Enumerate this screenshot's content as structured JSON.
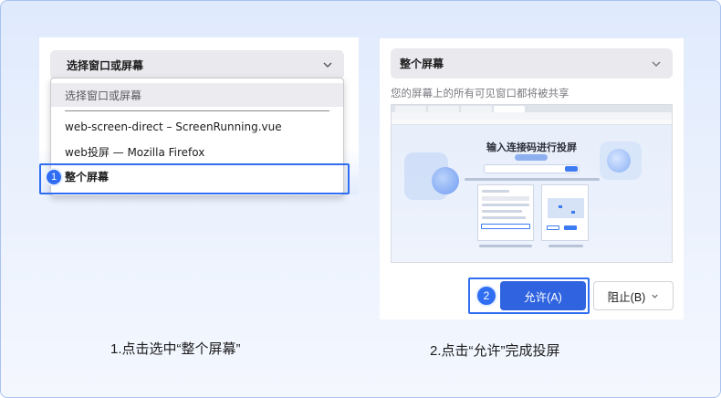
{
  "step1": {
    "select_header": "选择窗口或屏幕",
    "dropdown_placeholder": "选择窗口或屏幕",
    "options": [
      "web-screen-direct – ScreenRunning.vue",
      "web投屏 — Mozilla Firefox",
      "整个屏幕"
    ],
    "badge": "1",
    "caption": "1.点击选中“整个屏幕”"
  },
  "step2": {
    "header": "整个屏幕",
    "note": "您的屏幕上的所有可见窗口都将被共享",
    "preview_title": "输入连接码进行投屏",
    "allow_label": "允许(A)",
    "block_label": "阻止(B)",
    "badge": "2",
    "caption": "2.点击“允许”完成投屏"
  },
  "colors": {
    "accent": "#2f6df2",
    "allow_button": "#2f63e0",
    "frame_border": "#a9c3ef"
  },
  "icons": {
    "dropdown": "chevron-down-icon"
  }
}
